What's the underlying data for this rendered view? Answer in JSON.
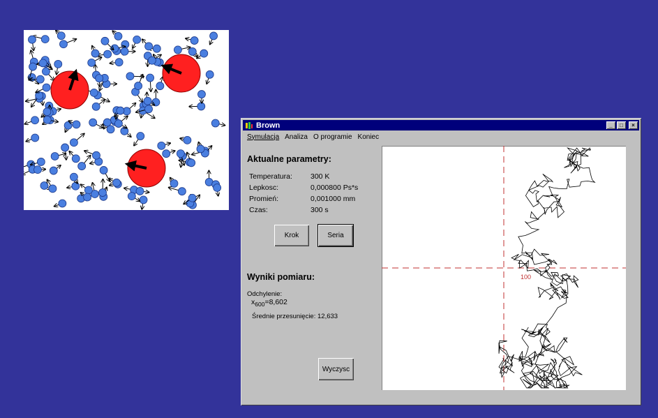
{
  "window": {
    "title": "Brown",
    "controls": [
      "_",
      "□",
      "×"
    ]
  },
  "menu": [
    "Symulacja",
    "Analiza",
    "O programie",
    "Koniec"
  ],
  "params": {
    "heading": "Aktualne parametry:",
    "rows": [
      {
        "label": "Temperatura:",
        "value": "300 K"
      },
      {
        "label": "Lepkosc:",
        "value": "0,000800 Ps*s"
      },
      {
        "label": "Promień:",
        "value": "0,001000 mm"
      },
      {
        "label": "Czas:",
        "value": "300 s"
      }
    ]
  },
  "buttons": {
    "step": "Krok",
    "series": "Seria",
    "clear": "Wyczysc"
  },
  "results": {
    "heading": "Wyniki pomiaru:",
    "deviation_label": "Odchylenie:",
    "deviation_symbol": "x",
    "deviation_subscript": "600",
    "deviation_value": "=8,602",
    "mean_shift": "Średnie przesunięcie: 12,633"
  },
  "plot": {
    "center_label": "100",
    "crosshair_color": "#c03030",
    "path_color": "#000000"
  },
  "illustration": {
    "large_particle_color": "#ff2020",
    "small_particle_color": "#4a7fe0"
  }
}
